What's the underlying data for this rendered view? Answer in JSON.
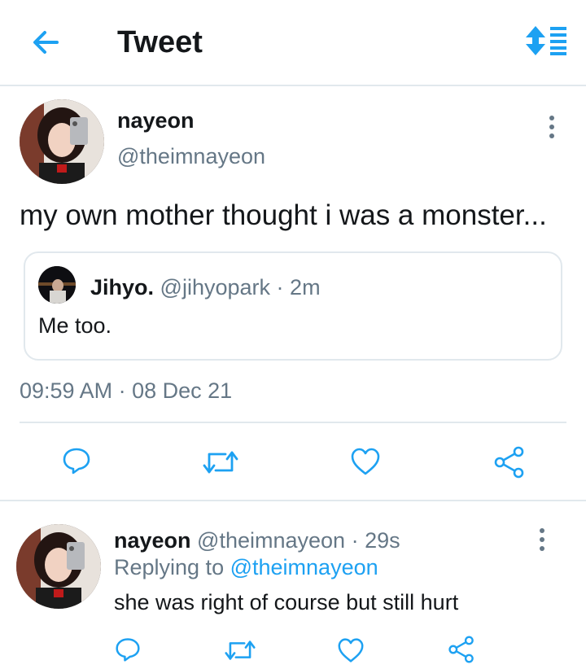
{
  "header": {
    "title": "Tweet",
    "back_icon": "arrow-left-icon",
    "sort_icon": "sort-icon"
  },
  "colors": {
    "accent": "#1da1f2",
    "secondary_text": "#657786",
    "border": "#e1e8ed",
    "text": "#14171a"
  },
  "tweet": {
    "name": "nayeon",
    "handle": "@theimnayeon",
    "text": "my own mother thought i was a monster...",
    "quote": {
      "name": "Jihyo.",
      "handle": "@jihyopark",
      "separator": "·",
      "time": "2m",
      "text": "Me too."
    },
    "time": "09:59 AM",
    "separator": "·",
    "date": "08 Dec 21",
    "actions": [
      "reply-icon",
      "retweet-icon",
      "like-icon",
      "share-icon"
    ]
  },
  "reply": {
    "name": "nayeon",
    "handle": "@theimnayeon",
    "separator": "·",
    "time": "29s",
    "replying_prefix": "Replying to",
    "replying_handle": "@theimnayeon",
    "text": "she was right of course but still hurt",
    "actions": [
      "reply-icon",
      "retweet-icon",
      "like-icon",
      "share-icon"
    ]
  }
}
